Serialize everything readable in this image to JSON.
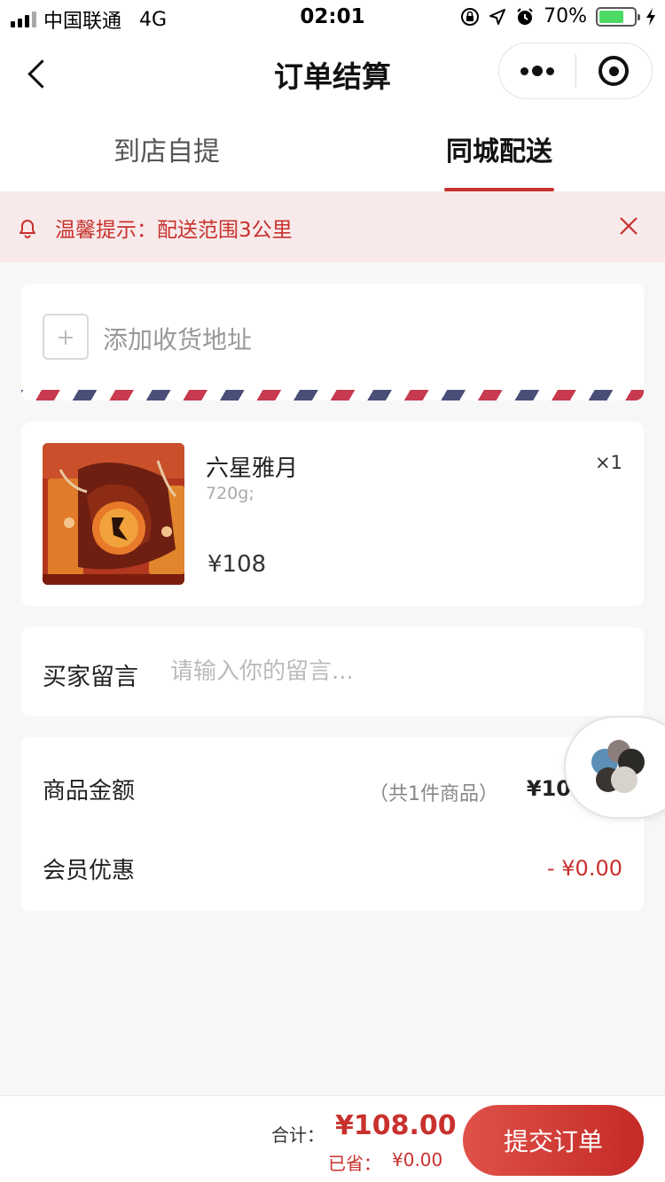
{
  "status_bar": {
    "carrier": "中国联通",
    "network": "4G",
    "time": "02:01",
    "battery_percent": "70%",
    "battery_level": 0.7
  },
  "nav": {
    "title": "订单结算",
    "icons": {
      "back": "back-arrow-icon",
      "more": "more-dots-icon",
      "close": "mini-program-close-icon"
    }
  },
  "tabs": [
    {
      "label": "到店自提",
      "active": false
    },
    {
      "label": "同城配送",
      "active": true
    }
  ],
  "notice": {
    "text": "温馨提示：配送范围3公里",
    "icon": "bell-icon",
    "close_icon": "close-icon"
  },
  "address": {
    "add_label": "添加收货地址"
  },
  "product": {
    "name": "六星雅月",
    "spec": "720g;",
    "price": "¥108",
    "qty": "×1"
  },
  "message": {
    "label": "买家留言",
    "placeholder": "请输入你的留言...",
    "value": ""
  },
  "summary": {
    "goods_label": "商品金额",
    "goods_count": "（共1件商品）",
    "goods_amount": "¥10",
    "member_label": "会员优惠",
    "member_discount": "- ¥0.00"
  },
  "footer": {
    "total_label": "合计：",
    "total_value": "¥108.00",
    "saved_label": "已省：",
    "saved_value": "¥0.00",
    "submit_label": "提交订单"
  },
  "colors": {
    "accent": "#c8312d",
    "notice_bg": "#f8eaea",
    "page_bg": "#f7f7f7"
  }
}
